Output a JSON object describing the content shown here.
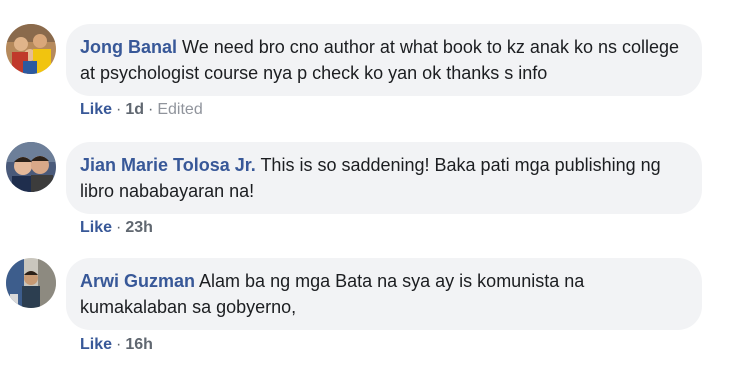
{
  "comments": [
    {
      "author": "Jong Banal",
      "text": "We need bro cno author at what book to kz anak ko ns college at psychologist course nya p check ko yan ok thanks s info",
      "like_label": "Like",
      "sep": "·",
      "time": "1d",
      "edited_label": "Edited"
    },
    {
      "author": "Jian Marie Tolosa Jr.",
      "text": "This is so saddening! Baka pati mga publishing ng libro nababayaran na!",
      "like_label": "Like",
      "sep": "·",
      "time": "23h"
    },
    {
      "author": "Arwi Guzman",
      "text": "Alam ba ng mga Bata na sya ay is komunista na kumakalaban sa gobyerno,",
      "like_label": "Like",
      "sep": "·",
      "time": "16h"
    }
  ],
  "colors": {
    "author_link": "#385898",
    "bubble_bg": "#f2f3f5",
    "meta_text": "#606770"
  }
}
